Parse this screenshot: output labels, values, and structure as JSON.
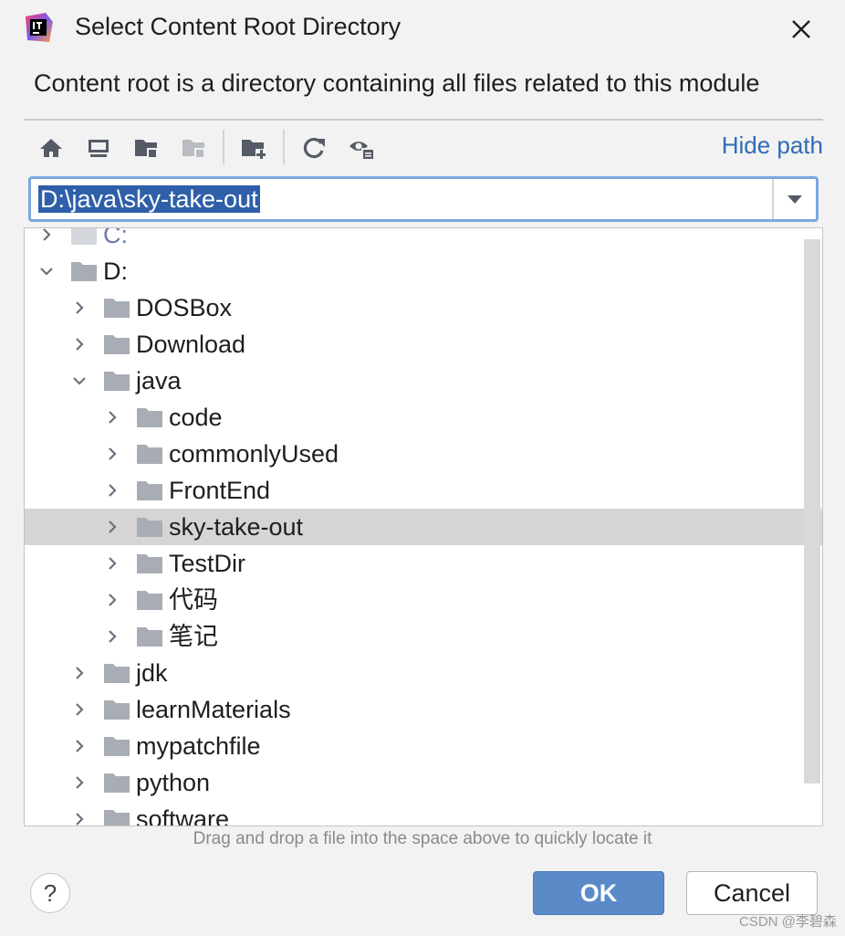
{
  "window": {
    "title": "Select Content Root Directory",
    "description": "Content root is a directory containing all files related to this module"
  },
  "toolbar": {
    "buttons": [
      "home-icon",
      "desktop-icon",
      "project-folder-icon",
      "module-folder-icon",
      "new-folder-icon",
      "refresh-icon",
      "show-hidden-icon"
    ],
    "hide_path_label": "Hide path"
  },
  "path": {
    "value": "D:\\java\\sky-take-out"
  },
  "tree": {
    "items": [
      {
        "label": "C:",
        "expanded": false,
        "depth": 0
      },
      {
        "label": "D:",
        "expanded": true,
        "depth": 0
      },
      {
        "label": "DOSBox",
        "expanded": false,
        "depth": 1
      },
      {
        "label": "Download",
        "expanded": false,
        "depth": 1
      },
      {
        "label": "java",
        "expanded": true,
        "depth": 1
      },
      {
        "label": "code",
        "expanded": false,
        "depth": 2
      },
      {
        "label": "commonlyUsed",
        "expanded": false,
        "depth": 2
      },
      {
        "label": "FrontEnd",
        "expanded": false,
        "depth": 2
      },
      {
        "label": "sky-take-out",
        "expanded": false,
        "depth": 2,
        "selected": true
      },
      {
        "label": "TestDir",
        "expanded": false,
        "depth": 2
      },
      {
        "label": "代码",
        "expanded": false,
        "depth": 2
      },
      {
        "label": "笔记",
        "expanded": false,
        "depth": 2
      },
      {
        "label": "jdk",
        "expanded": false,
        "depth": 1
      },
      {
        "label": "learnMaterials",
        "expanded": false,
        "depth": 1
      },
      {
        "label": "mypatchfile",
        "expanded": false,
        "depth": 1
      },
      {
        "label": "python",
        "expanded": false,
        "depth": 1
      },
      {
        "label": "software",
        "expanded": false,
        "depth": 1
      }
    ]
  },
  "hint": "Drag and drop a file into the space above to quickly locate it",
  "buttons": {
    "help": "?",
    "ok": "OK",
    "cancel": "Cancel"
  },
  "watermark": "CSDN @李碧森",
  "colors": {
    "accent": "#5b8ac8",
    "link": "#2f6cb5",
    "selection_row": "#d5d5d5",
    "folder": "#a8adb5"
  }
}
